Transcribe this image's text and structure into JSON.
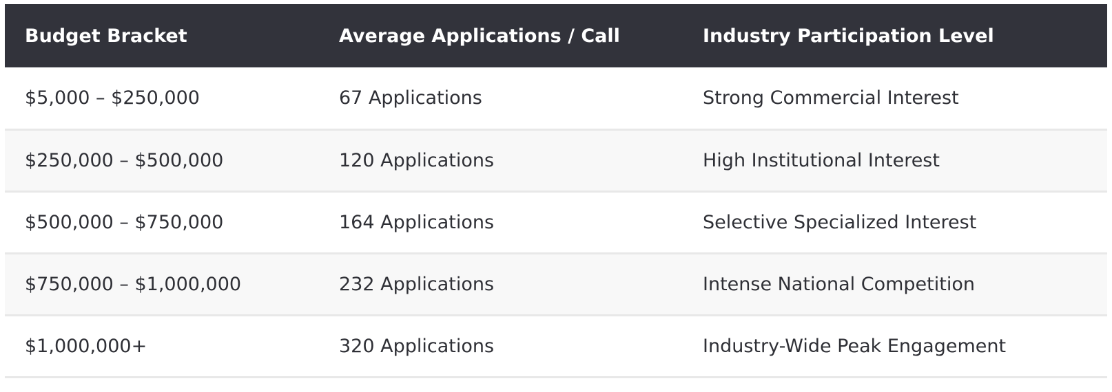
{
  "table": {
    "headers": [
      "Budget Bracket",
      "Average Applications / Call",
      "Industry Participation Level"
    ],
    "rows": [
      [
        "$5,000 – $250,000",
        "67 Applications",
        "Strong Commercial Interest"
      ],
      [
        "$250,000 – $500,000",
        "120 Applications",
        "High Institutional Interest"
      ],
      [
        "$500,000 – $750,000",
        "164 Applications",
        "Selective Specialized Interest"
      ],
      [
        "$750,000 – $1,000,000",
        "232 Applications",
        "Intense National Competition"
      ],
      [
        "$1,000,000+",
        "320 Applications",
        "Industry-Wide Peak Engagement"
      ]
    ]
  },
  "colors": {
    "header_background": "#32333b",
    "header_text": "#ffffff",
    "row_alt_background": "#f8f8f8",
    "row_border": "#e8e8e8",
    "body_text": "#2f3036"
  }
}
